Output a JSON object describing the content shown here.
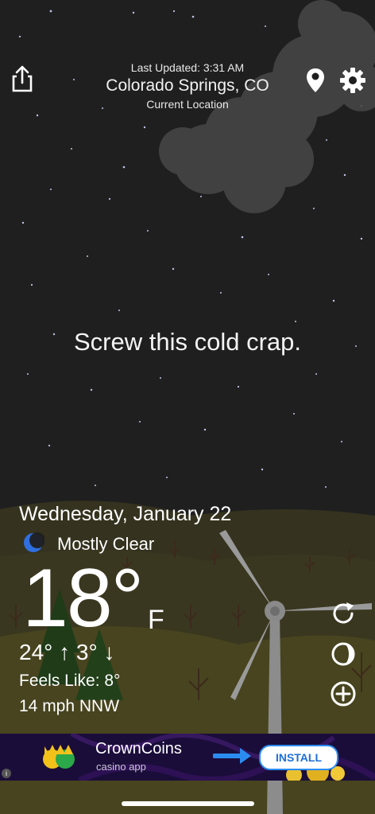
{
  "header": {
    "last_updated": "Last Updated: 3:31 AM",
    "city": "Colorado Springs, CO",
    "location_label": "Current Location"
  },
  "quip": "Screw this cold crap.",
  "weather": {
    "date": "Wednesday, January 22",
    "condition": "Mostly Clear",
    "temperature": "18°",
    "unit": "F",
    "high": "24°",
    "low": "3°",
    "feels_like": "Feels Like: 8°",
    "wind": "14 mph NNW"
  },
  "ad": {
    "title": "CrownCoins",
    "subtitle": "casino app",
    "install_label": "INSTALL",
    "info_glyph": "i"
  },
  "icons": {
    "share": "share-icon",
    "location": "location-pin-icon",
    "settings": "gear-icon",
    "refresh": "refresh-icon",
    "theme": "half-moon-icon",
    "add": "plus-circle-icon",
    "condition": "crescent-moon-icon"
  },
  "colors": {
    "sky": "#1f1f1f",
    "ground": "#3a3720",
    "accent_blue": "#2b8cf0"
  }
}
